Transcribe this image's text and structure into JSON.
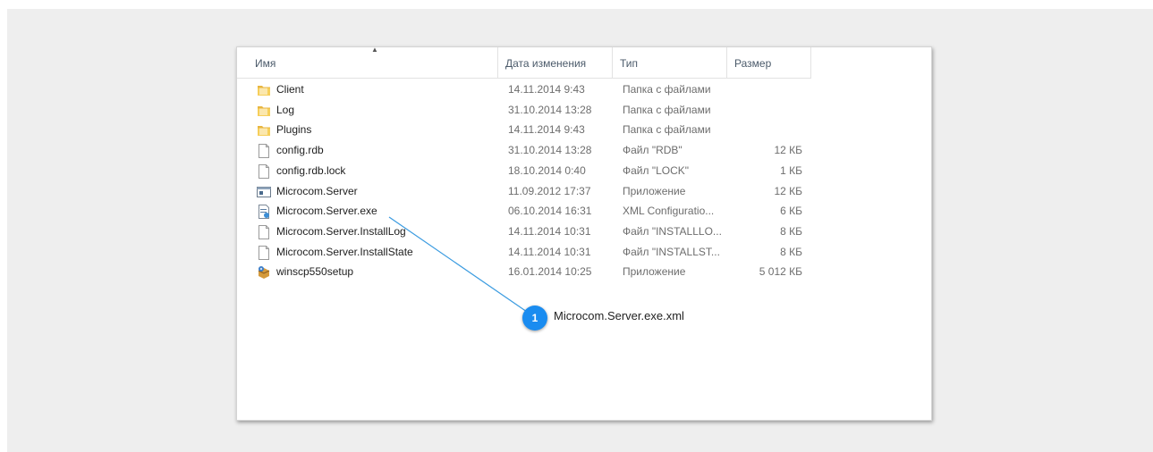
{
  "columns": {
    "name": "Имя",
    "date": "Дата изменения",
    "type": "Тип",
    "size": "Размер",
    "sort_indicator": "▲"
  },
  "files": [
    {
      "name": "Client",
      "date": "14.11.2014 9:43",
      "type": "Папка с файлами",
      "size": "",
      "icon": "folder-icon"
    },
    {
      "name": "Log",
      "date": "31.10.2014 13:28",
      "type": "Папка с файлами",
      "size": "",
      "icon": "folder-icon"
    },
    {
      "name": "Plugins",
      "date": "14.11.2014 9:43",
      "type": "Папка с файлами",
      "size": "",
      "icon": "folder-icon"
    },
    {
      "name": "config.rdb",
      "date": "31.10.2014 13:28",
      "type": "Файл \"RDB\"",
      "size": "12 КБ",
      "icon": "file-icon"
    },
    {
      "name": "config.rdb.lock",
      "date": "18.10.2014 0:40",
      "type": "Файл \"LOCK\"",
      "size": "1 КБ",
      "icon": "file-icon"
    },
    {
      "name": "Microcom.Server",
      "date": "11.09.2012 17:37",
      "type": "Приложение",
      "size": "12 КБ",
      "icon": "application-icon"
    },
    {
      "name": "Microcom.Server.exe",
      "date": "06.10.2014 16:31",
      "type": "XML Configuratio...",
      "size": "6 КБ",
      "icon": "xml-config-icon"
    },
    {
      "name": "Microcom.Server.InstallLog",
      "date": "14.11.2014 10:31",
      "type": "Файл \"INSTALLLO...",
      "size": "8 КБ",
      "icon": "file-icon"
    },
    {
      "name": "Microcom.Server.InstallState",
      "date": "14.11.2014 10:31",
      "type": "Файл \"INSTALLST...",
      "size": "8 КБ",
      "icon": "file-icon"
    },
    {
      "name": "winscp550setup",
      "date": "16.01.2014 10:25",
      "type": "Приложение",
      "size": "5 012 КБ",
      "icon": "installer-icon"
    }
  ],
  "callout": {
    "number": "1",
    "text": "Microcom.Server.exe.xml",
    "color": "#1a8cf0"
  }
}
